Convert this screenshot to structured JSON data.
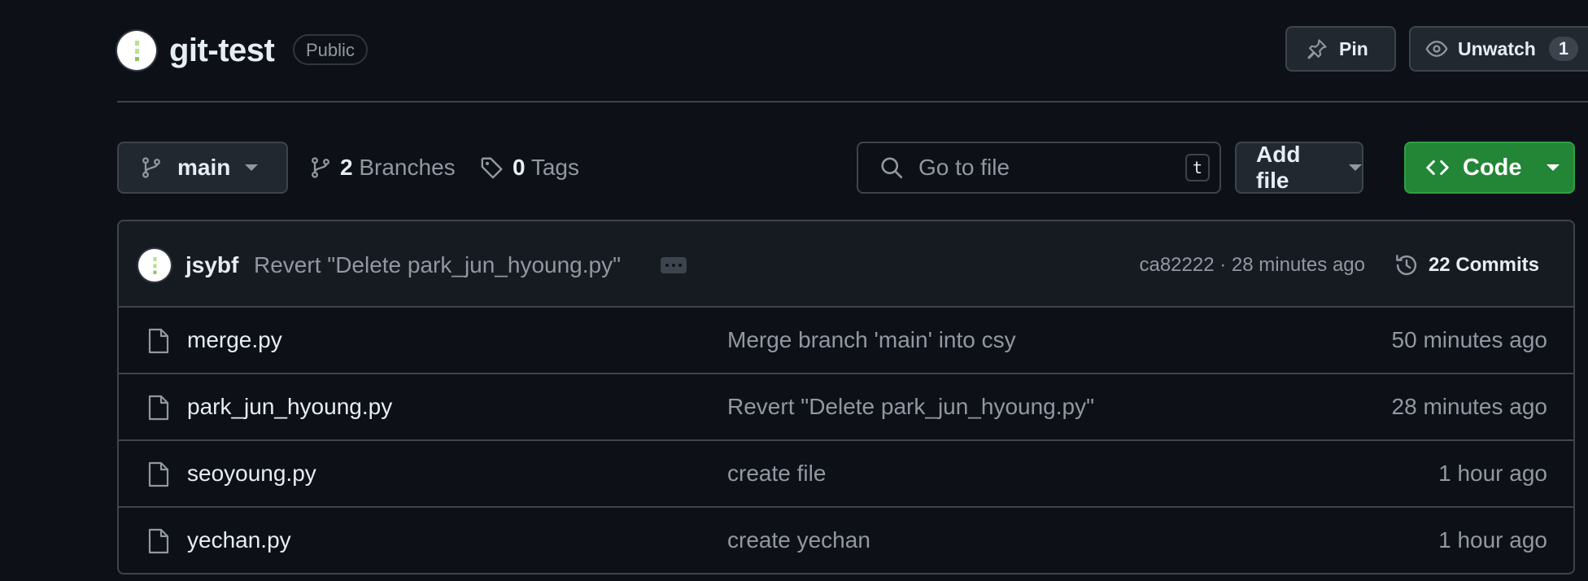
{
  "repo": {
    "name": "git-test",
    "visibility": "Public"
  },
  "actions": {
    "pin_label": "Pin",
    "watch_label": "Unwatch",
    "watch_count": "1"
  },
  "toolbar": {
    "branch": "main",
    "branches_count": "2",
    "branches_label": "Branches",
    "tags_count": "0",
    "tags_label": "Tags",
    "search_placeholder": "Go to file",
    "search_shortcut": "t",
    "add_file_label": "Add file",
    "code_label": "Code"
  },
  "latest_commit": {
    "author": "jsybf",
    "message": "Revert \"Delete park_jun_hyoung.py\"",
    "meta": "ca82222 · 28 minutes ago",
    "commits_label": "22 Commits"
  },
  "files": [
    {
      "name": "merge.py",
      "message": "Merge branch 'main' into csy",
      "time": "50 minutes ago"
    },
    {
      "name": "park_jun_hyoung.py",
      "message": "Revert \"Delete park_jun_hyoung.py\"",
      "time": "28 minutes ago"
    },
    {
      "name": "seoyoung.py",
      "message": "create file",
      "time": "1 hour ago"
    },
    {
      "name": "yechan.py",
      "message": "create yechan",
      "time": "1 hour ago"
    }
  ],
  "colors": {
    "background": "#0d1117",
    "border": "#3d444d",
    "text_primary": "#e6edf3",
    "text_muted": "#9198a1",
    "code_button": "#238636",
    "avatar_accent": "#b6e38a"
  },
  "icons": {
    "pin": "pin-icon",
    "watch": "eye-icon",
    "branch": "git-branch-icon",
    "tag": "tag-icon",
    "search": "search-icon",
    "code": "code-icon",
    "history": "history-icon",
    "file": "file-icon"
  }
}
